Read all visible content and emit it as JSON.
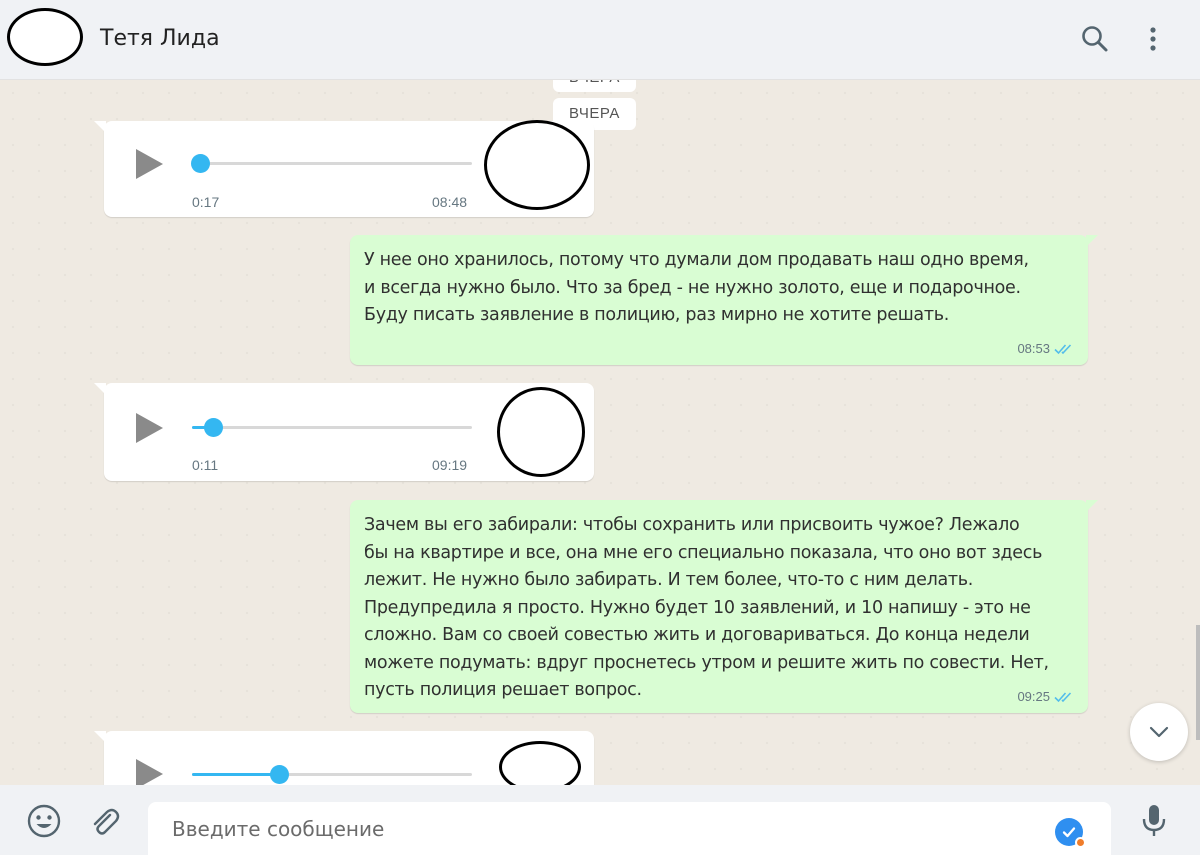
{
  "header": {
    "contact_name": "Тетя Лида",
    "icons": [
      "search-icon",
      "menu-dots-icon"
    ]
  },
  "chat": {
    "date_label_partial": "ВЧЕРА",
    "date_label": "ВЧЕРА",
    "messages": [
      {
        "type": "voice",
        "direction": "incoming",
        "duration": "0:17",
        "time": "08:48",
        "progress": 0.03
      },
      {
        "type": "text",
        "direction": "outgoing",
        "lines": [
          "У нее оно хранилось, потому что думали дом продавать наш одно время,",
          "и всегда нужно было. Что за бред - не нужно золото, еще и подарочное.",
          "Буду писать заявление в полицию, раз мирно не хотите решать."
        ],
        "time": "08:53",
        "status": "read"
      },
      {
        "type": "voice",
        "direction": "incoming",
        "duration": "0:11",
        "time": "09:19",
        "progress": 0.075
      },
      {
        "type": "text",
        "direction": "outgoing",
        "lines": [
          "Зачем вы его забирали: чтобы сохранить или присвоить чужое? Лежало",
          "бы на квартире и все, она мне его специально показала, что оно вот здесь",
          "лежит. Не нужно было забирать. И тем более, что-то с ним делать.",
          "Предупредила я просто. Нужно будет 10 заявлений, и 10 напишу - это не",
          "сложно. Вам со своей совестью жить и договариваться. До конца недели",
          "можете подумать: вдруг проснетесь утром и решите жить по совести. Нет,",
          "пусть полиция решает вопрос."
        ],
        "time": "09:25",
        "status": "read"
      },
      {
        "type": "voice",
        "direction": "incoming",
        "progress": 0.31
      }
    ]
  },
  "footer": {
    "input_placeholder": "Введите сообщение",
    "icons": [
      "emoji-icon",
      "attach-icon",
      "microphone-icon"
    ]
  },
  "colors": {
    "outgoing_bubble": "#d9fdd3",
    "incoming_bubble": "#ffffff",
    "accent": "#34b7f1",
    "read_check": "#53bdeb"
  }
}
